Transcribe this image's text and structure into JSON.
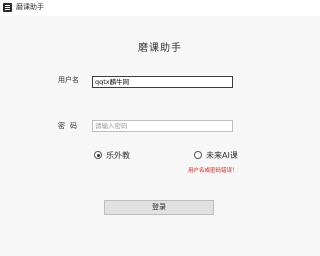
{
  "window": {
    "title": "磨课助手"
  },
  "form": {
    "heading": "磨课助手",
    "username_label": "用户名",
    "username_value": "qqtx麟牛网",
    "password_label": "密码",
    "password_placeholder": "请输入密码",
    "options": [
      {
        "label": "乐外教",
        "checked": true
      },
      {
        "label": "未来AI课",
        "checked": false
      }
    ],
    "error_message": "用户名或密码错误！",
    "login_label": "登录"
  }
}
